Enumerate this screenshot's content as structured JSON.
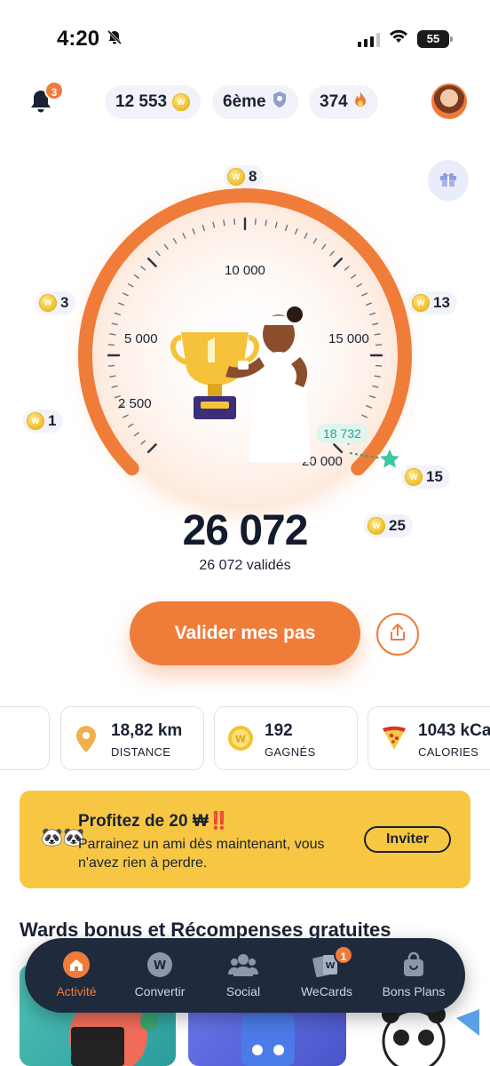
{
  "status_bar": {
    "time": "4:20",
    "battery": "55"
  },
  "header": {
    "notification_count": "3",
    "coins": "12 553",
    "rank": "6ème",
    "streak": "374"
  },
  "gauge": {
    "tick_labels": [
      "2 500",
      "5 000",
      "10 000",
      "15 000",
      "20 000"
    ],
    "rewards": [
      {
        "label": "8"
      },
      {
        "label": "3"
      },
      {
        "label": "13"
      },
      {
        "label": "1"
      },
      {
        "label": "15"
      },
      {
        "label": "25"
      }
    ],
    "current_steps_marker": "18 732",
    "progress": 1.0
  },
  "steps": {
    "total": "26 072",
    "validated": "26 072 validés"
  },
  "actions": {
    "validate_label": "Valider mes pas"
  },
  "stats": [
    {
      "value": "18,82 km",
      "label": "DISTANCE"
    },
    {
      "value": "192",
      "label": "GAGNÉS"
    },
    {
      "value": "1043 kCa",
      "label": "CALORIES"
    }
  ],
  "promo": {
    "title": "Profitez de 20 ₩‼️",
    "text": "Parrainez un ami dès maintenant, vous n'avez rien à perdre.",
    "button": "Inviter"
  },
  "section": {
    "title": "Wards bonus et Récompenses gratuites"
  },
  "nav": {
    "items": [
      {
        "label": "Activité",
        "active": true
      },
      {
        "label": "Convertir"
      },
      {
        "label": "Social"
      },
      {
        "label": "WeCards",
        "badge": "1"
      },
      {
        "label": "Bons Plans"
      }
    ]
  },
  "colors": {
    "accent": "#f07c3a",
    "nav_bg": "#1f2a3d",
    "promo_bg": "#f7c744",
    "marker": "#2aa58a"
  }
}
